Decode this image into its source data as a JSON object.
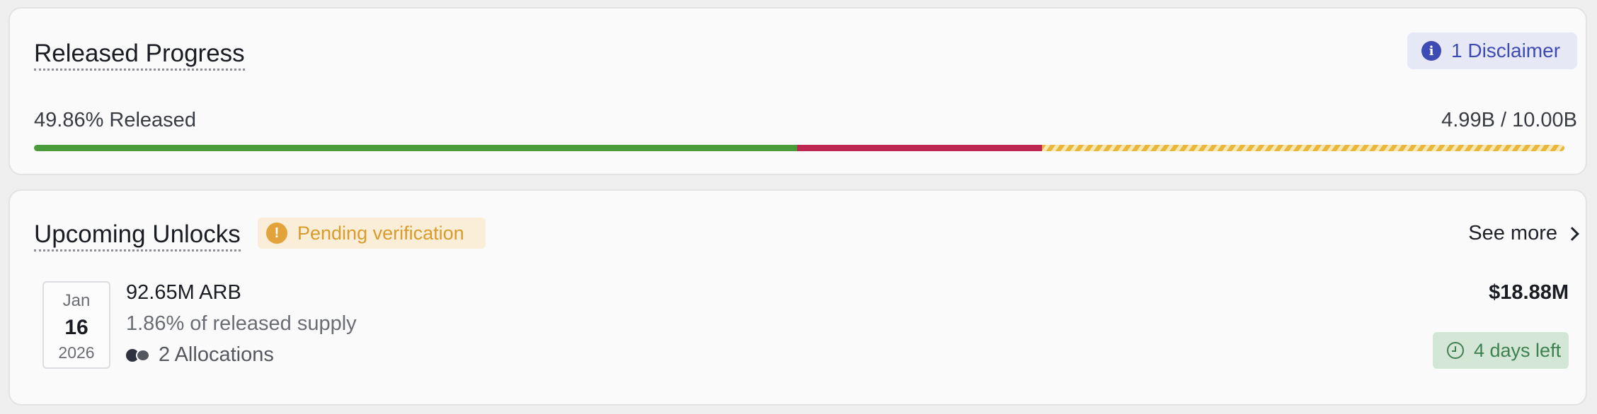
{
  "released_progress": {
    "title": "Released Progress",
    "disclaimer_label": "1 Disclaimer",
    "released_label": "49.86% Released",
    "released_total": "4.99B / 10.00B",
    "bar": {
      "segments": [
        {
          "name": "released",
          "fraction": 0.4986,
          "color": "#4a9c3b"
        },
        {
          "name": "unreleased",
          "fraction": 0.16,
          "color": "#bd2650"
        },
        {
          "name": "pending",
          "fraction": 0.3414,
          "color": "#e9b73a"
        }
      ]
    }
  },
  "upcoming_unlocks": {
    "title": "Upcoming Unlocks",
    "pending_badge": "Pending verification",
    "see_more": "See more",
    "items": [
      {
        "month": "Jan",
        "day": "16",
        "year": "2026",
        "amount": "92.65M ARB",
        "pct_supply": "1.86% of released supply",
        "allocations": "2 Allocations",
        "value": "$18.88M",
        "days_left": "4 days left"
      }
    ]
  },
  "icons": {
    "disclaimer": "info-icon",
    "pending": "exclamation-icon",
    "see_more": "chevron-right-icon",
    "days_left": "clock-icon",
    "allocations": "allocation-dots-icon"
  }
}
